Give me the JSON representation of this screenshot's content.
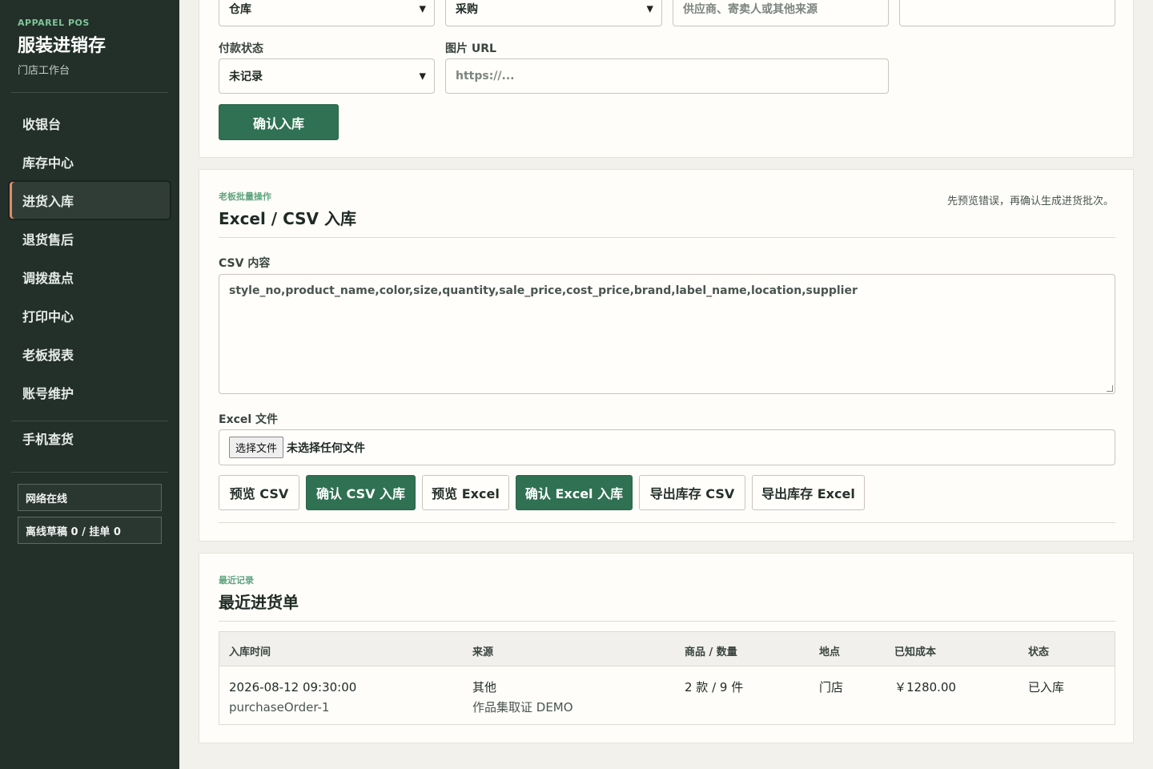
{
  "sidebar": {
    "brand_tag": "APPAREL POS",
    "brand_title": "服装进销存",
    "brand_sub": "门店工作台",
    "nav": [
      "收银台",
      "库存中心",
      "进货入库",
      "退货售后",
      "调拨盘点",
      "打印中心",
      "老板报表",
      "账号维护"
    ],
    "active_index": 2,
    "mobile_link": "手机查货",
    "status_online": "网络在线",
    "status_offline": "离线草稿 0 / 挂单 0"
  },
  "stock_in_form": {
    "location_value": "仓库",
    "type_value": "采购",
    "supplier_placeholder": "供应商、寄卖人或其他来源",
    "payment_label": "付款状态",
    "payment_value": "未记录",
    "image_label": "图片 URL",
    "image_placeholder": "https://...",
    "confirm_button": "确认入库"
  },
  "batch_import": {
    "tag": "老板批量操作",
    "title": "Excel / CSV 入库",
    "note": "先预览错误，再确认生成进货批次。",
    "csv_label": "CSV 内容",
    "csv_content": "style_no,product_name,color,size,quantity,sale_price,cost_price,brand,label_name,location,supplier",
    "excel_label": "Excel 文件",
    "file_button": "选择文件",
    "file_status": "未选择任何文件",
    "buttons": [
      "预览 CSV",
      "确认 CSV 入库",
      "预览 Excel",
      "确认 Excel 入库",
      "导出库存 CSV",
      "导出库存 Excel"
    ]
  },
  "recent": {
    "tag": "最近记录",
    "title": "最近进货单",
    "columns": [
      "入库时间",
      "来源",
      "商品 / 数量",
      "地点",
      "已知成本",
      "状态"
    ],
    "rows": [
      {
        "time": "2026-08-12 09:30:00",
        "order": "purchaseOrder-1",
        "source": "其他",
        "source_note": "作品集取证 DEMO",
        "items": "2 款 / 9 件",
        "location": "门店",
        "cost": "￥1280.00",
        "status": "已入库"
      }
    ]
  },
  "colors": {
    "sidebar_bg": "#233029",
    "primary": "#2f7152",
    "accent_tag": "#5fa47d",
    "active_marker": "#e08a6a"
  }
}
